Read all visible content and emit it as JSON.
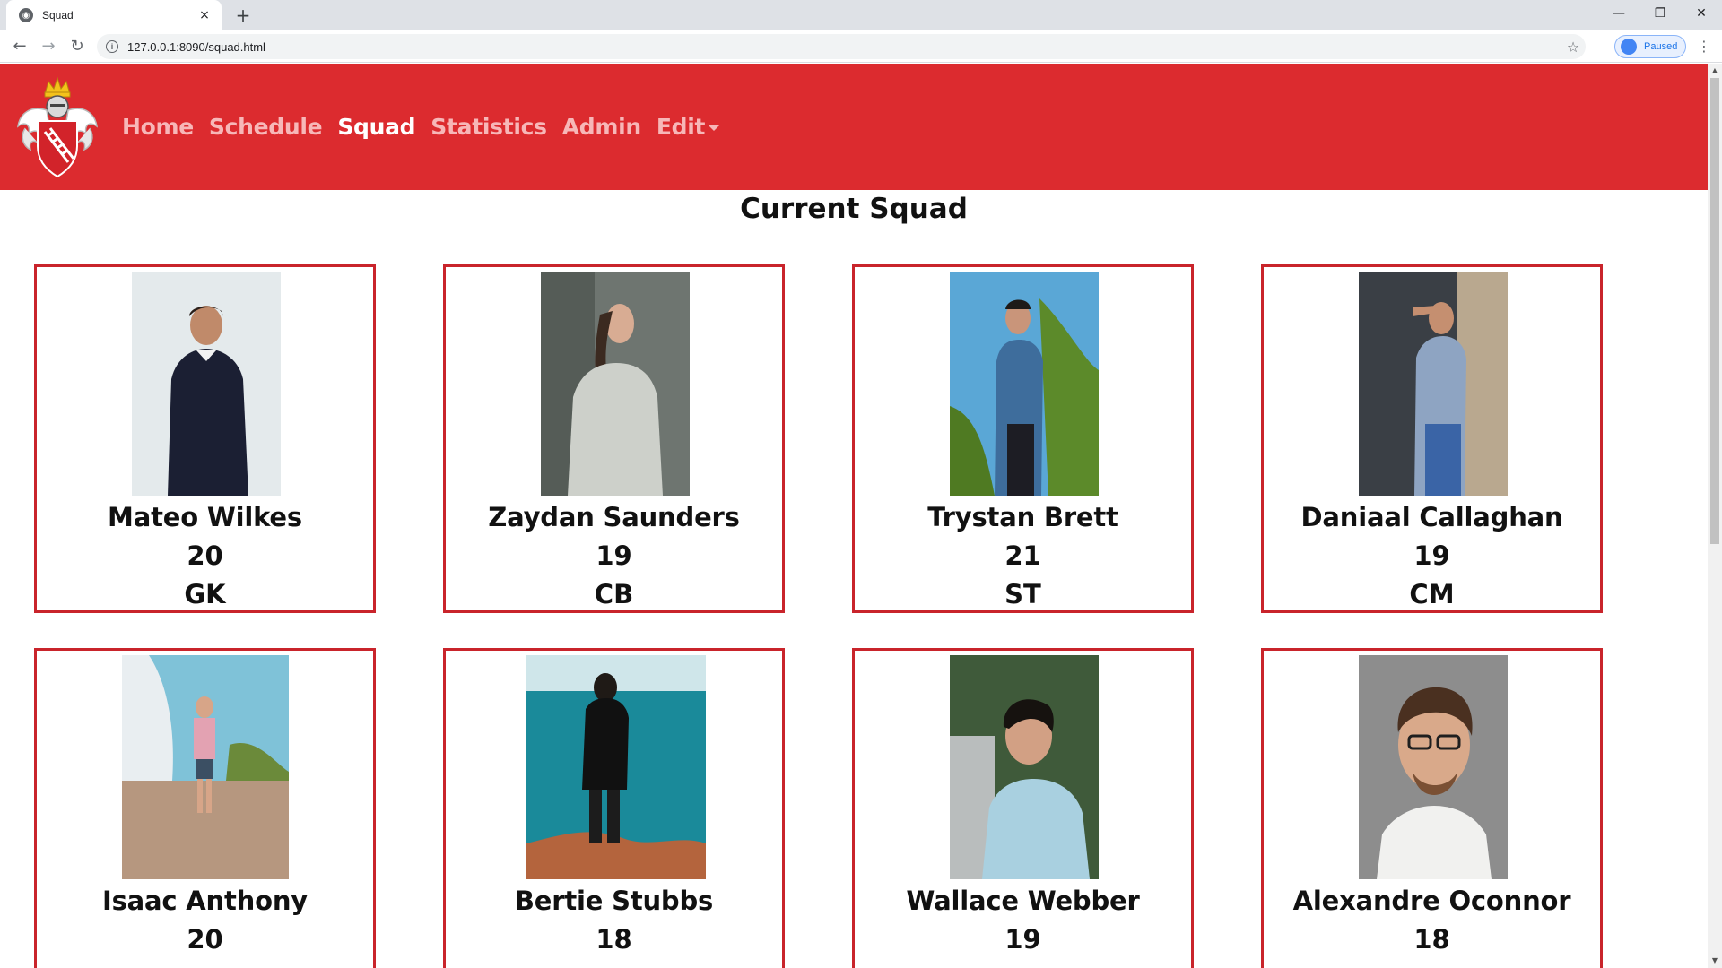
{
  "browser": {
    "tab_title": "Squad",
    "tab_close": "×",
    "new_tab": "+",
    "url": "127.0.0.1:8090/squad.html",
    "profile_label": "Paused",
    "back": "←",
    "forward": "→",
    "reload": "↻",
    "star": "☆",
    "menu": "⋮",
    "minimize": "—",
    "restore": "❐",
    "close": "✕"
  },
  "nav": {
    "home": "Home",
    "schedule": "Schedule",
    "squad": "Squad",
    "statistics": "Statistics",
    "admin": "Admin",
    "edit": "Edit"
  },
  "page": {
    "title": "Current Squad"
  },
  "players": [
    {
      "name": "Mateo Wilkes",
      "age": "20",
      "position": "GK"
    },
    {
      "name": "Zaydan Saunders",
      "age": "19",
      "position": "CB"
    },
    {
      "name": "Trystan Brett",
      "age": "21",
      "position": "ST"
    },
    {
      "name": "Daniaal Callaghan",
      "age": "19",
      "position": "CM"
    },
    {
      "name": "Isaac Anthony",
      "age": "20",
      "position": ""
    },
    {
      "name": "Bertie Stubbs",
      "age": "18",
      "position": ""
    },
    {
      "name": "Wallace Webber",
      "age": "19",
      "position": ""
    },
    {
      "name": "Alexandre Oconnor",
      "age": "18",
      "position": ""
    }
  ],
  "colors": {
    "header": "#dc2b2f",
    "nav_inactive": "#f7b7b8",
    "nav_active": "#ffffff",
    "card_border": "#c9242b"
  }
}
